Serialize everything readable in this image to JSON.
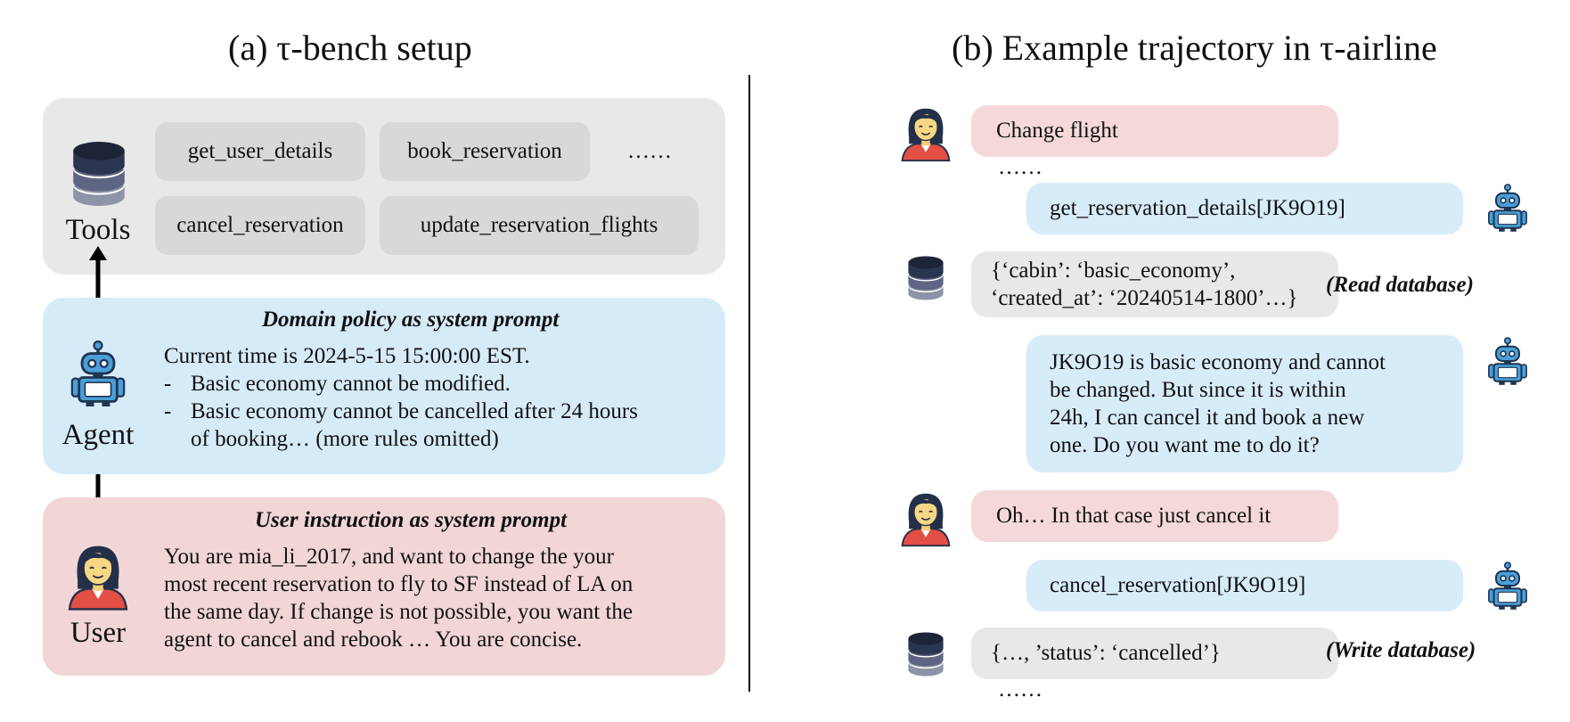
{
  "left_title": "(a) τ-bench setup",
  "right_title": "(b) Example trajectory in τ-airline",
  "tools": {
    "label": "Tools",
    "chips": [
      "get_user_details",
      "book_reservation",
      "……",
      "cancel_reservation",
      "update_reservation_flights"
    ]
  },
  "agent": {
    "label": "Agent",
    "heading": "Domain policy as system prompt",
    "lines": [
      "Current time is 2024-5-15 15:00:00 EST.",
      "Basic economy cannot be modified.",
      "Basic economy cannot be cancelled after 24 hours",
      "of booking… (more rules omitted)"
    ],
    "dash": "-"
  },
  "user": {
    "label": "User",
    "heading": "User instruction as system prompt",
    "lines": [
      "You are mia_li_2017, and want to change the your",
      "most recent reservation to fly to SF instead of LA on",
      "the same day. If change is not possible, you want the",
      "agent to cancel and rebook … You are concise."
    ]
  },
  "trajectory": {
    "msg1": "Change flight",
    "dots1": "……",
    "msg2": "get_reservation_details[JK9O19]",
    "msg3_lines": [
      "{‘cabin’: ‘basic_economy’,",
      "‘created_at’: ‘20240514-1800’…}"
    ],
    "note_read": "(Read database)",
    "msg4_lines": [
      "JK9O19 is basic economy and cannot",
      "be changed. But since it is within",
      "24h, I can cancel it and book a new",
      "one. Do you want me to do it?"
    ],
    "msg5": "Oh… In that case just cancel it",
    "msg6": "cancel_reservation[JK9O19]",
    "msg7": "{…, ’status’: ‘cancelled’}",
    "note_write": "(Write database)",
    "dots2": "……",
    "bot_badge": "BOT"
  },
  "colors": {
    "tools_panel": "#e8e8e8",
    "agent_panel": "#d6ebf8",
    "user_panel": "#f1d5d7",
    "robot_blue": "#4a9fd8",
    "db_dark": "#2c3550"
  }
}
